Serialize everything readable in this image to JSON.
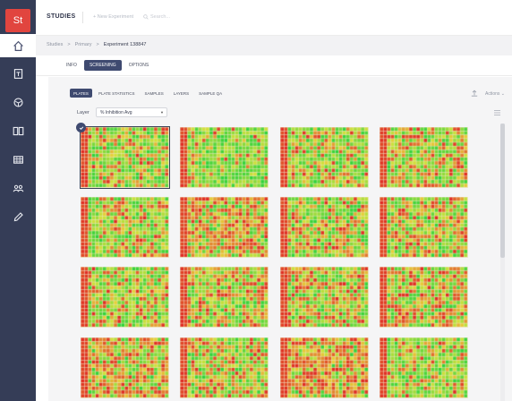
{
  "app": {
    "logo": "St",
    "title": "STUDIES",
    "new_experiment": "+ New Experiment",
    "search_placeholder": "Search..."
  },
  "sidebar": {
    "icons": [
      "home-icon",
      "document-icon",
      "cube-icon",
      "book-icon",
      "grid-icon",
      "users-icon",
      "pipette-icon"
    ]
  },
  "breadcrumb": {
    "items": [
      "Studies",
      ">",
      "Primary",
      ">"
    ],
    "current": "Experiment 138847"
  },
  "tabs": [
    "INFO",
    "SCREENING",
    "OPTIONS"
  ],
  "active_tab": "SCREENING",
  "subtabs": [
    "PLATES",
    "PLATE STATISTICS",
    "SAMPLES",
    "LAYERS",
    "SAMPLE QA"
  ],
  "active_subtab": "PLATES",
  "actions_label": "Actions",
  "layer": {
    "label": "Layer",
    "value": "% Inhibition Avg"
  },
  "colors": {
    "accent": "#3f4a70",
    "sidebar": "#353d57",
    "logo": "#e1453f",
    "heat_low": "#2fd33a",
    "heat_mid": "#e6e23a",
    "heat_high": "#e02a22",
    "control_column": "#d72b22"
  },
  "plates": [
    {
      "selected": true,
      "red_level": 0.3
    },
    {
      "selected": false,
      "red_level": 0.12
    },
    {
      "selected": false,
      "red_level": 0.3
    },
    {
      "selected": false,
      "red_level": 0.4
    },
    {
      "selected": false,
      "red_level": 0.3
    },
    {
      "selected": false,
      "red_level": 0.62
    },
    {
      "selected": false,
      "red_level": 0.35
    },
    {
      "selected": false,
      "red_level": 0.45
    },
    {
      "selected": false,
      "red_level": 0.35
    },
    {
      "selected": false,
      "red_level": 0.42
    },
    {
      "selected": false,
      "red_level": 0.45
    },
    {
      "selected": false,
      "red_level": 0.48
    },
    {
      "selected": false,
      "red_level": 0.55
    },
    {
      "selected": false,
      "red_level": 0.45
    },
    {
      "selected": false,
      "red_level": 0.72
    },
    {
      "selected": false,
      "red_level": 0.25
    }
  ]
}
